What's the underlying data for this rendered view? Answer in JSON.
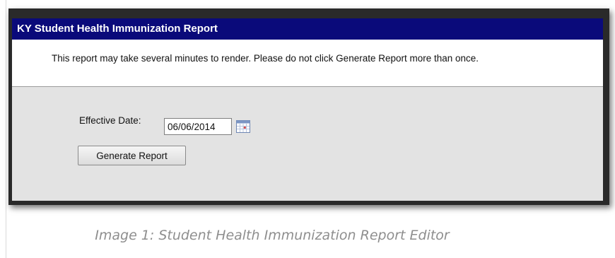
{
  "window": {
    "title": "KY Student Health Immunization Report",
    "notice": "This report may take several minutes to render. Please do not click Generate Report more than once."
  },
  "form": {
    "effective_date_label": "Effective Date:",
    "effective_date_value": "06/06/2014",
    "calendar_icon": "calendar-icon",
    "generate_label": "Generate Report"
  },
  "caption": "Image 1: Student Health Immunization Report Editor",
  "colors": {
    "titlebar_bg": "#0a0a7a",
    "titlebar_text": "#ffffff",
    "panel_bg": "#e3e3e3",
    "caption_text": "#8e8e8e"
  }
}
